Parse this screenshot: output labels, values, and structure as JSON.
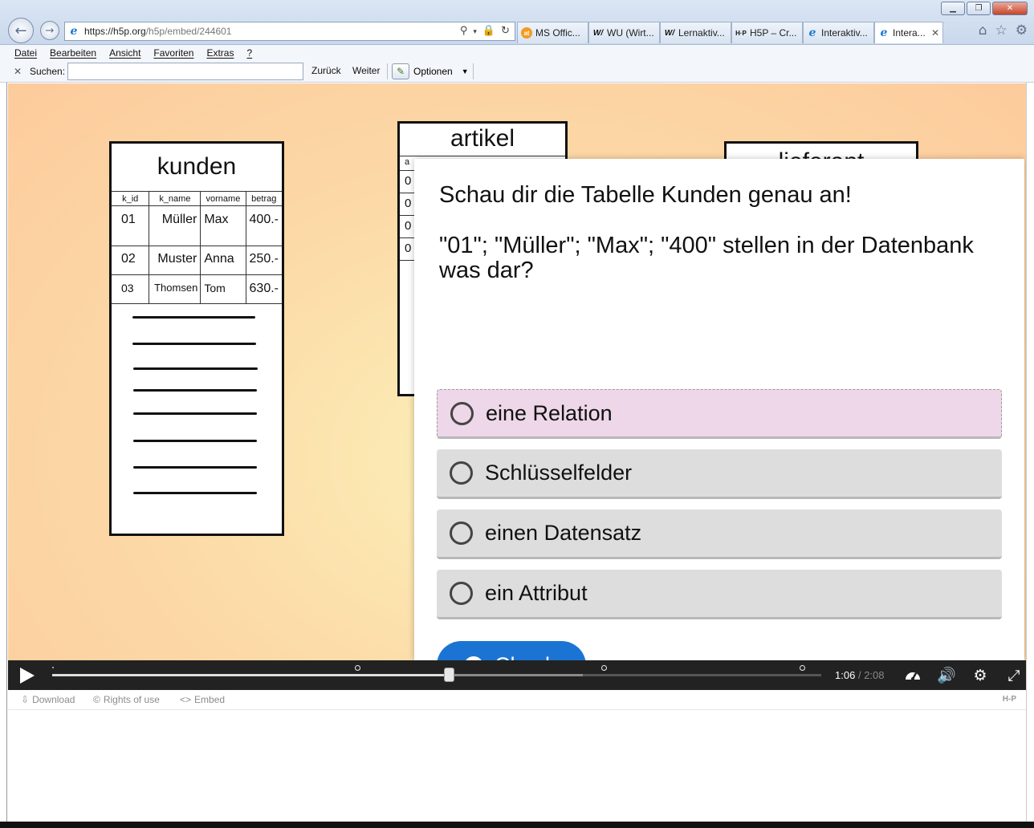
{
  "browser": {
    "url_main": "https://h5p.org",
    "url_path": "/h5p/embed/244601",
    "tabs": [
      {
        "icon": "ms-office-icon",
        "label": "MS Offic..."
      },
      {
        "icon": "wu-icon",
        "label": "WU (Wirt..."
      },
      {
        "icon": "wu-icon",
        "label": "Lernaktiv..."
      },
      {
        "icon": "h5p-icon",
        "label": "H5P – Cr..."
      },
      {
        "icon": "ie-icon",
        "label": "Interaktiv..."
      },
      {
        "icon": "ie-icon",
        "label": "Intera..."
      }
    ],
    "menu": [
      "Datei",
      "Bearbeiten",
      "Ansicht",
      "Favoriten",
      "Extras",
      "?"
    ],
    "search": {
      "label": "Suchen:",
      "value": "",
      "back": "Zurück",
      "next": "Weiter",
      "options": "Optionen"
    }
  },
  "slide": {
    "kunden": {
      "title": "kunden",
      "columns": [
        "k_id",
        "k_name",
        "vorname",
        "betrag"
      ],
      "rows": [
        [
          "01",
          "Müller",
          "Max",
          "400.-"
        ],
        [
          "02",
          "Muster",
          "Anna",
          "250.-"
        ],
        [
          "03",
          "Thomsen",
          "Tom",
          "630.-"
        ]
      ]
    },
    "artikel": {
      "title": "artikel",
      "header_fragment": "a",
      "row_fragments": [
        "0",
        "0",
        "0",
        "0"
      ]
    },
    "lieferant": {
      "title": "lieferant"
    }
  },
  "question": {
    "text_1": "Schau dir die Tabelle Kunden genau an!",
    "text_2": "\"01\"; \"Müller\"; \"Max\"; \"400\" stellen in der Datenbank was dar?",
    "answers": [
      "eine Relation",
      "Schlüsselfelder",
      "einen Datensatz",
      "ein Attribut"
    ],
    "check_label": "Check"
  },
  "video": {
    "current_time": "1:06",
    "separator": "/",
    "duration": "2:08",
    "progress": 0.516,
    "buffered": 0.69
  },
  "footer": {
    "download": "Download",
    "rights": "Rights of use",
    "embed": "Embed",
    "logo": "H-P"
  },
  "colors": {
    "check_button": "#1b74d3",
    "answer_hover": "#edd7e8",
    "answer_bg": "#dddddd",
    "control_bar": "#222222"
  }
}
